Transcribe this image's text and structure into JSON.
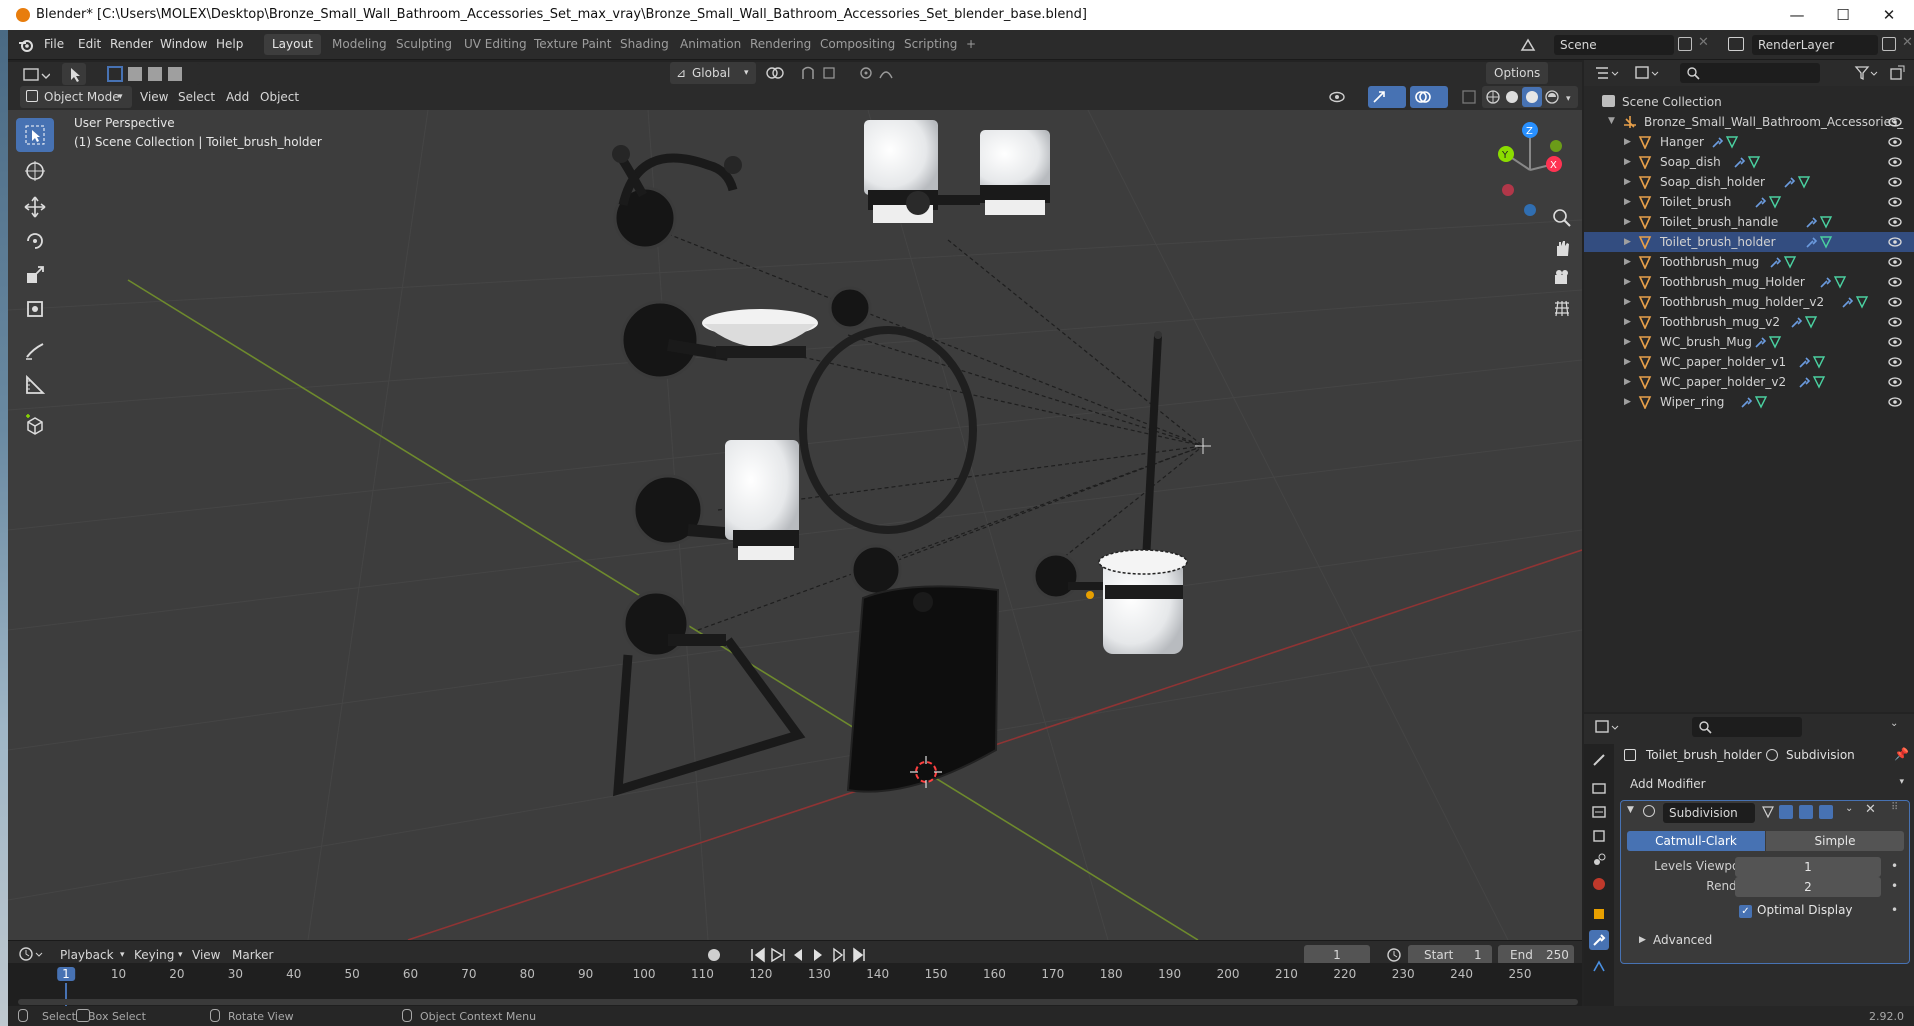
{
  "window": {
    "title": "Blender* [C:\\Users\\MOLEX\\Desktop\\Bronze_Small_Wall_Bathroom_Accessories_Set_max_vray\\Bronze_Small_Wall_Bathroom_Accessories_Set_blender_base.blend]",
    "minimize": "—",
    "maximize": "☐",
    "close": "✕"
  },
  "menu": [
    "File",
    "Edit",
    "Render",
    "Window",
    "Help"
  ],
  "workspaces": [
    "Layout",
    "Modeling",
    "Sculpting",
    "UV Editing",
    "Texture Paint",
    "Shading",
    "Animation",
    "Rendering",
    "Compositing",
    "Scripting",
    "+"
  ],
  "scene": {
    "name": "Scene",
    "render_layer": "RenderLayer"
  },
  "viewport_header": {
    "mode": "Object Mode",
    "menus": [
      "View",
      "Select",
      "Add",
      "Object"
    ],
    "transform": "Global",
    "options": "Options"
  },
  "viewport": {
    "perspective": "User Perspective",
    "collection_info": "(1) Scene Collection | Toilet_brush_holder",
    "gizmo": {
      "z": "Z",
      "y": "Y",
      "x": "X"
    }
  },
  "outliner": {
    "root": "Scene Collection",
    "collection": "Bronze_Small_Wall_Bathroom_Accessories_",
    "items": [
      "Hanger",
      "Soap_dish",
      "Soap_dish_holder",
      "Toilet_brush",
      "Toilet_brush_handle",
      "Toilet_brush_holder",
      "Toothbrush_mug",
      "Toothbrush_mug_Holder",
      "Toothbrush_mug_holder_v2",
      "Toothbrush_mug_v2",
      "WC_brush_Mug",
      "WC_paper_holder_v1",
      "WC_paper_holder_v2",
      "Wiper_ring"
    ],
    "selected": "Toilet_brush_holder"
  },
  "properties": {
    "object": "Toilet_brush_holder",
    "modifier_context": "Subdivision",
    "add_modifier": "Add Modifier",
    "modifier_name": "Subdivision",
    "method_a": "Catmull-Clark",
    "method_b": "Simple",
    "levels_viewport_label": "Levels Viewport",
    "levels_viewport": "1",
    "render_label": "Render",
    "render": "2",
    "optimal_display": "Optimal Display",
    "advanced": "Advanced"
  },
  "timeline": {
    "menus": [
      "Playback",
      "Keying",
      "View",
      "Marker"
    ],
    "current_frame": "1",
    "start_label": "Start",
    "start": "1",
    "end_label": "End",
    "end": "250",
    "ticks": [
      "1",
      "10",
      "20",
      "30",
      "40",
      "50",
      "60",
      "70",
      "80",
      "90",
      "100",
      "110",
      "120",
      "130",
      "140",
      "150",
      "160",
      "170",
      "180",
      "190",
      "200",
      "210",
      "220",
      "230",
      "240",
      "250"
    ]
  },
  "statusbar": {
    "select": "Select",
    "box_select": "Box Select",
    "rotate_view": "Rotate View",
    "context_menu": "Object Context Menu",
    "version": "2.92.0"
  },
  "colors": {
    "accent": "#4772b3",
    "active_tool": "#4772b3",
    "blender_orange": "#e87d0d",
    "x_axis": "#ff3352",
    "y_axis": "#8bdc00",
    "z_axis": "#2890ff"
  }
}
